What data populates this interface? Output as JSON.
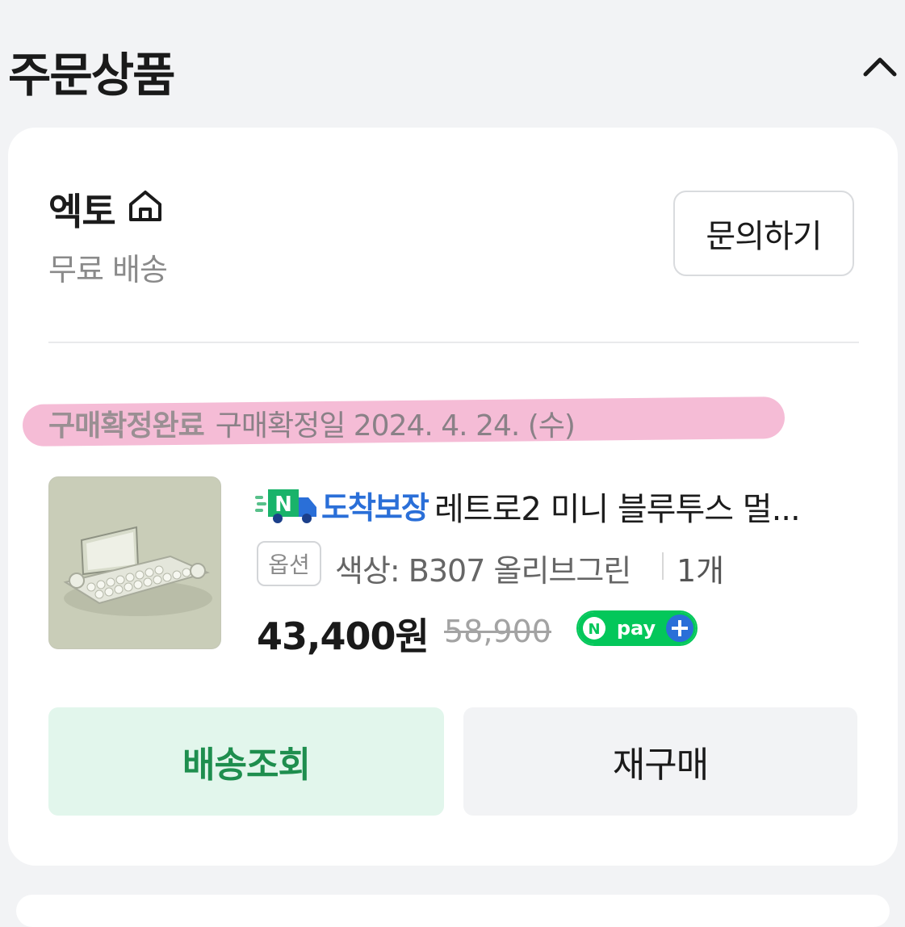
{
  "header": {
    "title": "주문상품"
  },
  "store": {
    "name": "엑토",
    "shipping": "무료 배송",
    "inquiry_label": "문의하기"
  },
  "order": {
    "status": "구매확정완료",
    "confirm_date": "구매확정일 2024. 4. 24. (수)"
  },
  "product": {
    "badge": "도착보장",
    "badge_logo_letter": "N",
    "name": "레트로2 미니 블루투스 멀...",
    "option_tag": "옵션",
    "option_value": "색상: B307 올리브그린",
    "quantity": "1개",
    "price": "43,400원",
    "original_price": "58,900",
    "pay_badge": "pay"
  },
  "actions": {
    "track_label": "배송조회",
    "rebuy_label": "재구매"
  },
  "colors": {
    "accent_green": "#1e8e4e",
    "badge_blue": "#2a6fd8",
    "highlight_pink": "#f2a6c8",
    "npay_green": "#03c75a"
  }
}
